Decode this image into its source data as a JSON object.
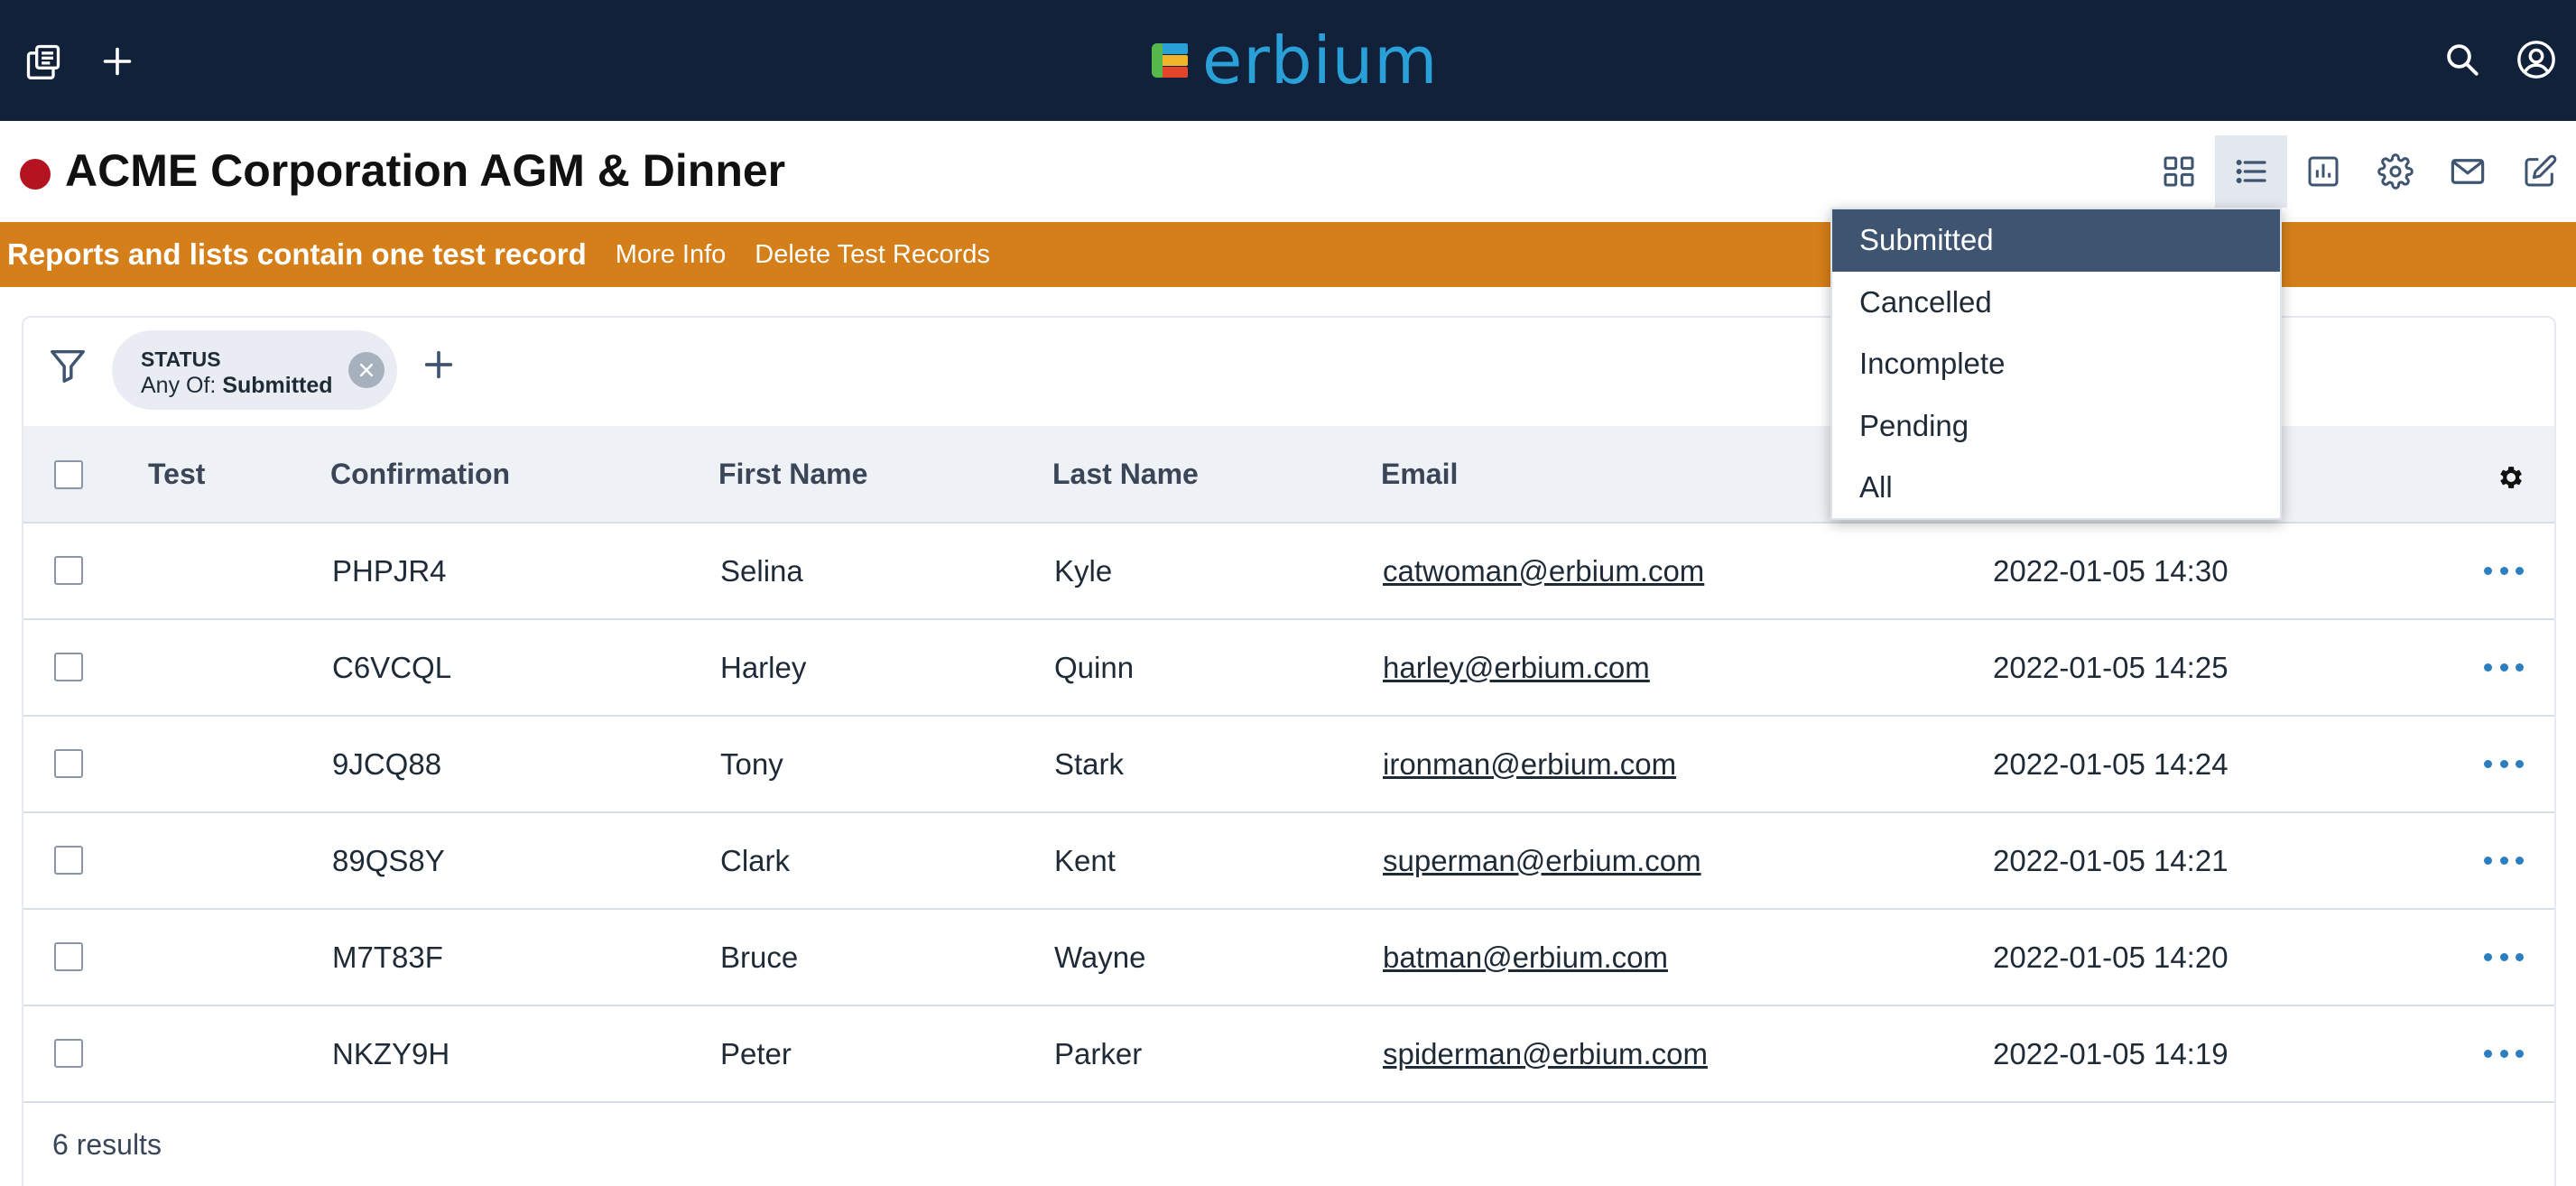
{
  "topbar": {
    "left_icons": [
      "copy-pages-icon",
      "plus-icon"
    ],
    "right_icons": [
      "search-icon",
      "account-icon"
    ],
    "brand": "erbium",
    "brand_colors": {
      "text": "#2aa0d8",
      "mark_top": "#2aa0d8",
      "mark_mid": "#f2b529",
      "mark_bottom": "#e2452b",
      "mark_stem": "#55b84a"
    },
    "background": "#12213a"
  },
  "event": {
    "title": "ACME Corporation AGM & Dinner",
    "status_color": "#b3141f",
    "view_icons": [
      "grid-view-icon",
      "list-view-icon",
      "reports-chart-icon",
      "settings-gear-icon",
      "email-icon",
      "edit-icon"
    ],
    "active_view": "list-view-icon"
  },
  "banner": {
    "message": "Reports and lists contain one test record",
    "more_info": "More Info",
    "delete_test": "Delete Test Records",
    "background": "#d57f1a"
  },
  "filter": {
    "chip_label": "STATUS",
    "chip_prefix": "Any Of: ",
    "chip_value": "Submitted"
  },
  "table": {
    "headers": {
      "test": "Test",
      "confirmation": "Confirmation",
      "first_name": "First Name",
      "last_name": "Last Name",
      "email": "Email"
    },
    "rows": [
      {
        "confirmation": "PHPJR4",
        "first_name": "Selina",
        "last_name": "Kyle",
        "email": "catwoman@erbium.com",
        "date": "2022-01-05 14:30"
      },
      {
        "confirmation": "C6VCQL",
        "first_name": "Harley",
        "last_name": "Quinn",
        "email": "harley@erbium.com",
        "date": "2022-01-05 14:25"
      },
      {
        "confirmation": "9JCQ88",
        "first_name": "Tony",
        "last_name": "Stark",
        "email": "ironman@erbium.com",
        "date": "2022-01-05 14:24"
      },
      {
        "confirmation": "89QS8Y",
        "first_name": "Clark",
        "last_name": "Kent",
        "email": "superman@erbium.com",
        "date": "2022-01-05 14:21"
      },
      {
        "confirmation": "M7T83F",
        "first_name": "Bruce",
        "last_name": "Wayne",
        "email": "batman@erbium.com",
        "date": "2022-01-05 14:20"
      },
      {
        "confirmation": "NKZY9H",
        "first_name": "Peter",
        "last_name": "Parker",
        "email": "spiderman@erbium.com",
        "date": "2022-01-05 14:19"
      }
    ],
    "results": "6 results"
  },
  "status_dropdown": {
    "options": [
      "Submitted",
      "Cancelled",
      "Incomplete",
      "Pending",
      "All"
    ],
    "selected": "Submitted",
    "selected_bg": "#3e5470"
  }
}
